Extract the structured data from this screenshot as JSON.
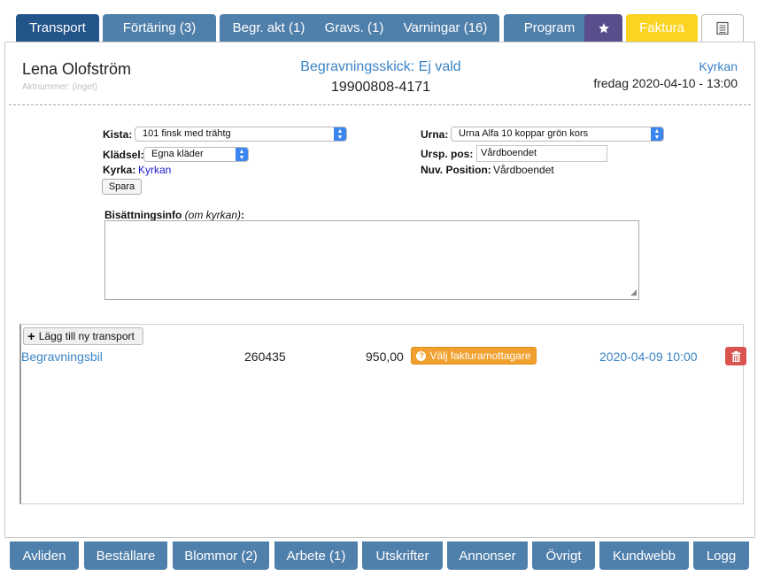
{
  "top_tabs": [
    {
      "label": "Transport"
    },
    {
      "label": "Förtäring (3)"
    },
    {
      "label": "Begr. akt (1)"
    },
    {
      "label": "Gravs. (1)"
    },
    {
      "label": "Varningar (16)"
    },
    {
      "label": "Program"
    },
    {
      "label": "",
      "icon": "star-icon"
    },
    {
      "label": "Faktura"
    },
    {
      "label": "",
      "icon": "document-list-icon"
    }
  ],
  "header": {
    "name": "Lena Olofström",
    "aktnummer": "Aktnummer: (inget)",
    "begravningsskick": "Begravningsskick: Ej vald",
    "personnummer": "19900808-4171",
    "kyrka": "Kyrkan",
    "datum": "fredag 2020-04-10 - 13:00"
  },
  "form": {
    "kista_label": "Kista:",
    "kista_value": "101 finsk med trähtg",
    "kladsel_label": "Klädsel:",
    "kladsel_value": "Egna kläder",
    "kyrka_label": "Kyrka:",
    "kyrka_value": "Kyrkan",
    "spara_label": "Spara",
    "urna_label": "Urna:",
    "urna_value": "Urna Alfa 10 koppar grön kors",
    "ursp_pos_label": "Ursp. pos:",
    "ursp_pos_value": "Vårdboendet",
    "nuv_position_label": "Nuv. Position:",
    "nuv_position_value": "Vårdboendet",
    "bisattning_label": "Bisättningsinfo",
    "bisattning_sub": "(om kyrkan)",
    "bisattning_colon": ":",
    "bisattning_value": ""
  },
  "transport": {
    "add_label": "Lägg till ny transport",
    "rows": [
      {
        "type": "Begravningsbil",
        "code": "260435",
        "amount": "950,00",
        "invoice_button": "Välj fakturamottagare",
        "date": "2020-04-09 10:00"
      }
    ]
  },
  "bottom_tabs": [
    {
      "label": "Avliden"
    },
    {
      "label": "Beställare"
    },
    {
      "label": "Blommor (2)"
    },
    {
      "label": "Arbete (1)"
    },
    {
      "label": "Utskrifter"
    },
    {
      "label": "Annonser"
    },
    {
      "label": "Övrigt"
    },
    {
      "label": "Kundwebb"
    },
    {
      "label": "Logg"
    }
  ],
  "colors": {
    "tab_blue": "#4f7fab",
    "tab_active": "#23548a",
    "star_tab": "#5a4d8c",
    "faktura_tab": "#fbd321",
    "link_blue": "#3a84c6",
    "orange": "#f0a02e",
    "danger": "#d9534f"
  }
}
